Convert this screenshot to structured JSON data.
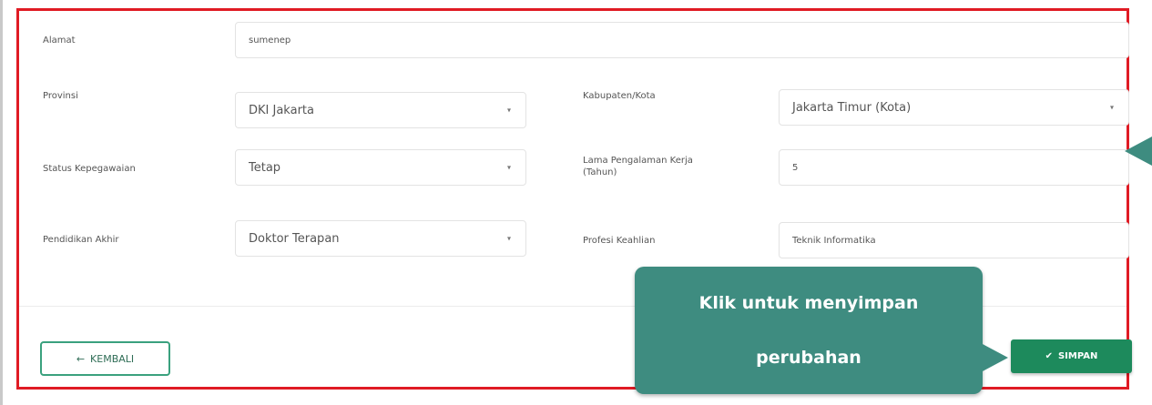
{
  "form": {
    "alamat": {
      "label": "Alamat",
      "value": "sumenep"
    },
    "provinsi": {
      "label": "Provinsi",
      "value": "DKI Jakarta"
    },
    "kabupaten": {
      "label": "Kabupaten/Kota",
      "value": "Jakarta Timur (Kota)"
    },
    "status": {
      "label": "Status Kepegawaian",
      "value": "Tetap"
    },
    "lama": {
      "label_line1": "Lama Pengalaman Kerja",
      "label_line2": "(Tahun)",
      "value": "5"
    },
    "pendidikan": {
      "label": "Pendidikan Akhir",
      "value": "Doktor Terapan"
    },
    "profesi": {
      "label": "Profesi Keahlian",
      "value": "Teknik Informatika"
    }
  },
  "actions": {
    "back_icon": "←",
    "back_label": "KEMBALI",
    "save_icon": "✔",
    "save_label": "SIMPAN"
  },
  "callout": {
    "line1": "Klik untuk menyimpan",
    "line2": "perubahan"
  },
  "icons": {
    "caret": "▾"
  },
  "colors": {
    "frame_border": "#e01b24",
    "callout_bg": "#3e8c80",
    "save_button": "#1d8a5c",
    "back_border": "#3aa17e"
  }
}
